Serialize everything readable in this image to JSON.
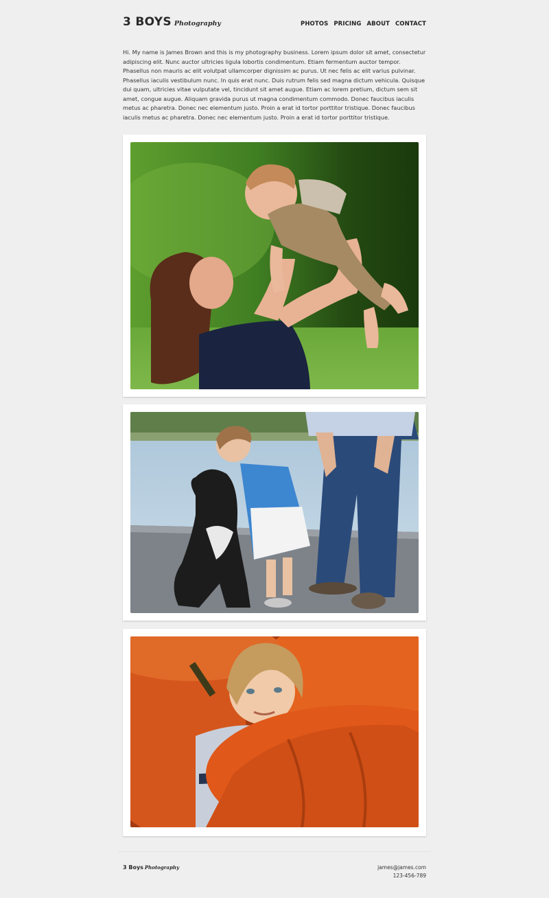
{
  "header": {
    "logo_main": "3 BOYS",
    "logo_sub": "Photography",
    "nav": [
      "PHOTOS",
      "PRICING",
      "ABOUT",
      "CONTACT"
    ]
  },
  "intro": {
    "text": "Hi. My name is James Brown and this is my photography business. Lorem ipsum dolor sit amet, consectetur adipiscing elit. Nunc auctor ultricies ligula lobortis condimentum. Etiam fermentum auctor tempor. Phasellus non mauris ac elit volutpat ullamcorper dignissim ac purus. Ut nec felis ac elit varius pulvinar. Phasellus iaculis vestibulum nunc. In quis erat nunc. Duis rutrum felis sed magna dictum vehicula. Quisque dui quam, ultricies vitae vulputate vel, tincidunt sit amet augue. Etiam ac lorem pretium, dictum sem sit amet, congue augue. Aliquam gravida purus ut magna condimentum commodo. Donec faucibus iaculis metus ac pharetra. Donec nec elementum justo. Proin a erat id tortor porttitor tristique. Donec faucibus iaculis metus ac pharetra. Donec nec elementum justo. Proin a erat id tortor porttitor tristique."
  },
  "footer": {
    "logo_main": "3 Boys",
    "logo_sub": "Photography",
    "email": "james@james.com",
    "phone": "123-456-789"
  },
  "colors": {
    "background": "#efefef",
    "card": "#ffffff",
    "text": "#333333"
  }
}
